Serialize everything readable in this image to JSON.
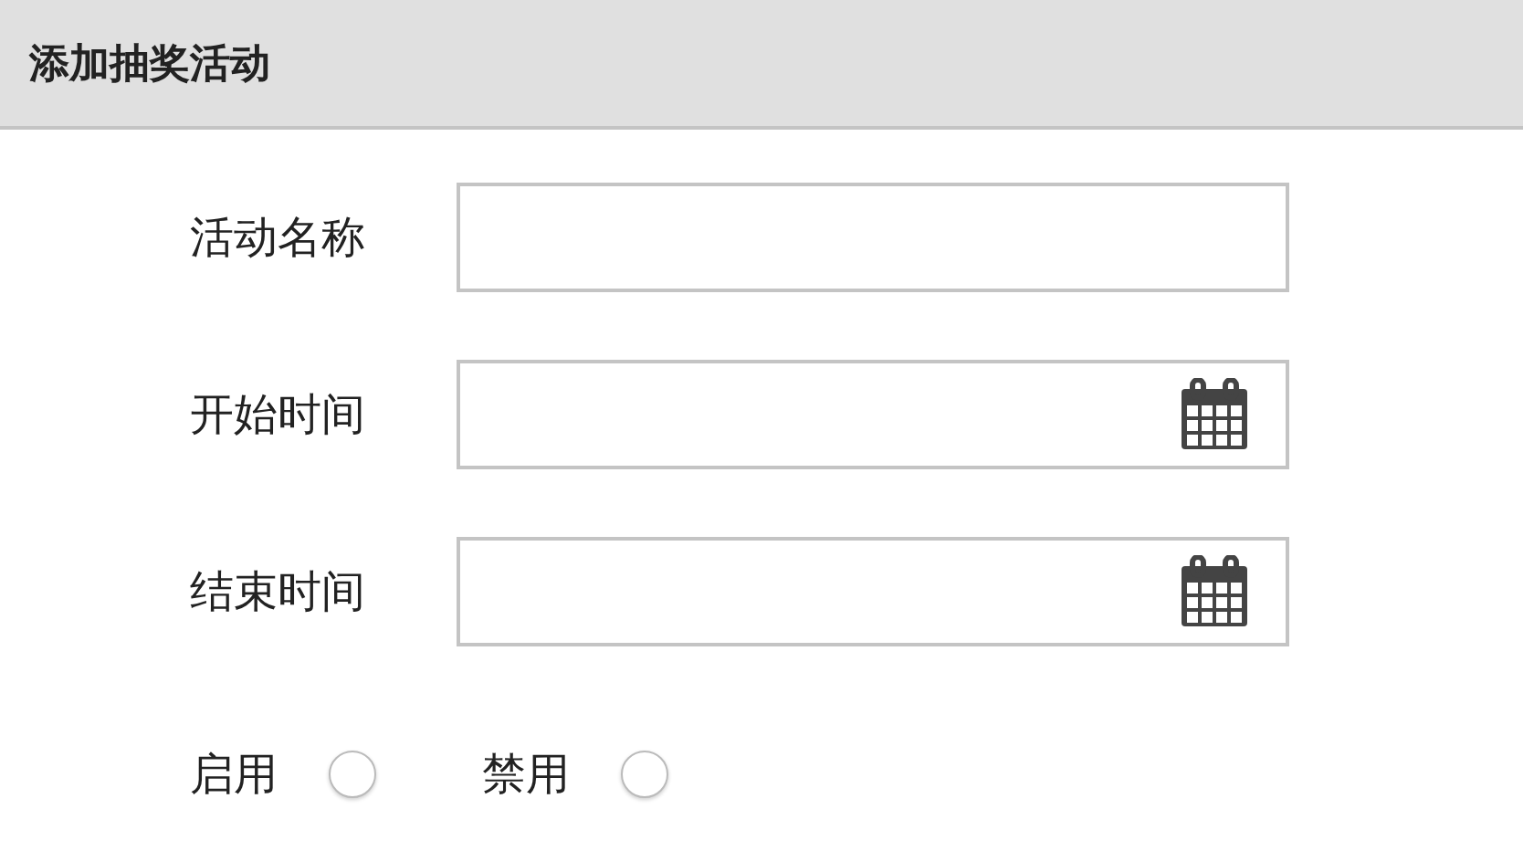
{
  "header": {
    "title": "添加抽奖活动"
  },
  "fields": [
    {
      "label": "活动名称",
      "kind": "text"
    },
    {
      "label": "开始时间",
      "kind": "date"
    },
    {
      "label": "结束时间",
      "kind": "date"
    }
  ],
  "status_options": [
    {
      "label": "启用",
      "selected": false
    },
    {
      "label": "禁用",
      "selected": false
    }
  ]
}
